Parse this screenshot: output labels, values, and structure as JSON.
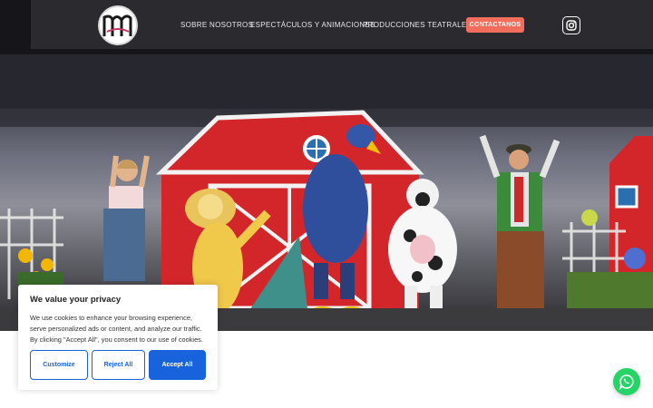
{
  "nav": {
    "links": [
      {
        "label": "SOBRE NOSOTROS"
      },
      {
        "label": "ESPECTÁCULOS Y ANIMACIONES"
      },
      {
        "label": "PRODUCCIONES TEATRALES"
      }
    ],
    "contact_label": "CONTACTANOS",
    "logo_icon": "theatre-logo-icon",
    "instagram_icon": "instagram-icon"
  },
  "hero": {
    "image_icon": "stage-photo",
    "colors": {
      "barn_red": "#d3262b",
      "curtain_dark": "#17171c"
    }
  },
  "cookie": {
    "title": "We value your privacy",
    "text": "We use cookies to enhance your browsing experience, serve personalized ads or content, and analyze our traffic. By clicking \"Accept All\", you consent to our use of cookies.",
    "customize_label": "Customize",
    "reject_label": "Reject All",
    "accept_label": "Accept All",
    "accent_color": "#1863dc"
  },
  "whatsapp": {
    "icon": "whatsapp-icon",
    "color": "#25d366"
  },
  "colors": {
    "contact_button": "#f26d5b"
  }
}
